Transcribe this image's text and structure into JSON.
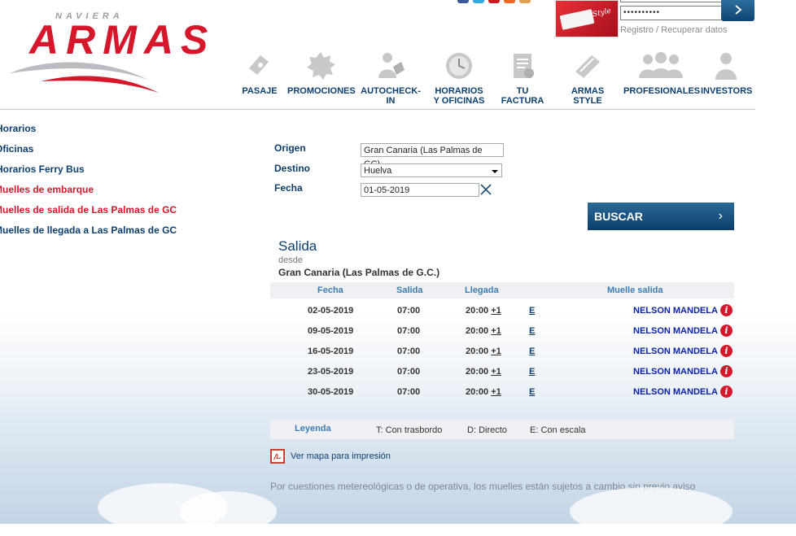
{
  "brand": {
    "naviera": "NAVIERA",
    "armas": "ARMAS",
    "red": "#d6172b",
    "navy": "#0d3f6e"
  },
  "login": {
    "password_value": "••••••••••",
    "submit_icon": "chevron-right-icon",
    "registro": "Registro",
    "separator": "/",
    "recuperar": "Recuperar datos"
  },
  "promo": {
    "text": "Style"
  },
  "nav": [
    {
      "label": "PASAJE",
      "icon": "ticket-icon"
    },
    {
      "label": "PROMOCIONES",
      "icon": "starburst-icon"
    },
    {
      "label": "AUTOCHECK-IN",
      "icon": "person-ticket-icon"
    },
    {
      "label": "HORARIOS Y OFICINAS",
      "icon": "clock-icon"
    },
    {
      "label": "TU FACTURA",
      "icon": "invoice-icon"
    },
    {
      "label": "ARMAS STYLE",
      "icon": "card-icon"
    },
    {
      "label": "PROFESIONALES",
      "icon": "group-icon"
    },
    {
      "label": "INVESTORS",
      "icon": "person-icon"
    }
  ],
  "sidebar": [
    {
      "label": "Horarios"
    },
    {
      "label": "Oficinas"
    },
    {
      "label": "Horarios Ferry Bus"
    },
    {
      "label": "Muelles de embarque"
    },
    {
      "label": "Muelles de salida de Las Palmas de GC"
    },
    {
      "label": "Muelles de llegada a Las Palmas de GC"
    }
  ],
  "form": {
    "origen_label": "Origen",
    "origen_value": "Gran Canaria (Las Palmas de GC)",
    "destino_label": "Destino",
    "destino_value": "Huelva",
    "fecha_label": "Fecha",
    "fecha_value": "01-05-2019",
    "buscar_label": "BUSCAR"
  },
  "results": {
    "title": "Salida",
    "desde": "desde",
    "origin": "Gran Canaria (Las Palmas de G.C.)",
    "headers": {
      "fecha": "Fecha",
      "salida": "Salida",
      "llegada": "Llegada",
      "muelle": "Muelle salida"
    },
    "rows": [
      {
        "fecha": "02-05-2019",
        "salida": "07:00",
        "llegada": "20:00",
        "plus": "+1",
        "tipo": "E",
        "muelle": "NELSON MANDELA",
        "info": "i"
      },
      {
        "fecha": "09-05-2019",
        "salida": "07:00",
        "llegada": "20:00",
        "plus": "+1",
        "tipo": "E",
        "muelle": "NELSON MANDELA",
        "info": "i"
      },
      {
        "fecha": "16-05-2019",
        "salida": "07:00",
        "llegada": "20:00",
        "plus": "+1",
        "tipo": "E",
        "muelle": "NELSON MANDELA",
        "info": "i"
      },
      {
        "fecha": "23-05-2019",
        "salida": "07:00",
        "llegada": "20:00",
        "plus": "+1",
        "tipo": "E",
        "muelle": "NELSON MANDELA",
        "info": "i"
      },
      {
        "fecha": "30-05-2019",
        "salida": "07:00",
        "llegada": "20:00",
        "plus": "+1",
        "tipo": "E",
        "muelle": "NELSON MANDELA",
        "info": "i"
      }
    ]
  },
  "legend": {
    "title": "Leyenda",
    "items": [
      {
        "key": "T:",
        "text": "Con trasbordo"
      },
      {
        "key": "D:",
        "text": "Directo"
      },
      {
        "key": "E:",
        "text": "Con escala"
      }
    ]
  },
  "print_link": "Ver mapa para impresión",
  "note": "Por cuestiones metereológicas o de operativa, los muelles están sujetos a cambio sin previo aviso"
}
